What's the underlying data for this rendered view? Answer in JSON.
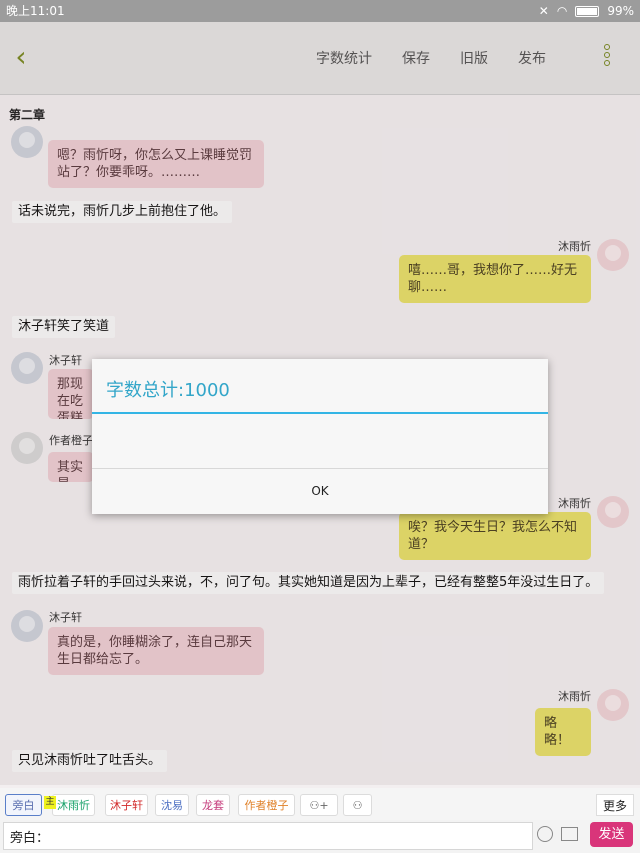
{
  "status_bar": {
    "time": "晚上11:01",
    "battery": "99%"
  },
  "toolbar": {
    "back_icon": "chevron-left",
    "actions": [
      "字数统计",
      "保存",
      "旧版",
      "发布"
    ],
    "more_icon": "vertical-dots"
  },
  "chapter": "第二章",
  "messages": [
    {
      "type": "left",
      "name": "",
      "text": "嗯？雨忻呀，你怎么又上课睡觉罚站了？你要乖呀。………"
    },
    {
      "type": "narration",
      "text": "话未说完，雨忻几步上前抱住了他。"
    },
    {
      "type": "right",
      "name": "沐雨忻",
      "text": "嘻……哥，我想你了……好无聊……"
    },
    {
      "type": "narration",
      "text": "沐子轩笑了笑道"
    },
    {
      "type": "left",
      "name": "沐子轩",
      "text": "那现在吃蛋糕"
    },
    {
      "type": "left",
      "name": "作者橙子",
      "text": "其实是"
    },
    {
      "type": "right",
      "name": "沐雨忻",
      "text": "唉？我今天生日？我怎么不知道？"
    },
    {
      "type": "narration",
      "text": "雨忻拉着子轩的手回过头来说，不，问了句。其实她知道是因为上辈子，已经有整整5年没过生日了。"
    },
    {
      "type": "left",
      "name": "沐子轩",
      "text": "真的是，你睡糊涂了，连自己那天生日都给忘了。"
    },
    {
      "type": "right",
      "name": "沐雨忻",
      "text": "略略！"
    },
    {
      "type": "narration",
      "text": "只见沐雨忻吐了吐舌头。"
    }
  ],
  "dialog": {
    "title": "字数总计:1000",
    "ok_label": "OK"
  },
  "roles": [
    {
      "label": "旁白",
      "color": "#5a6fb0"
    },
    {
      "label": "沐雨忻",
      "color": "#1aa36b"
    },
    {
      "label": "沐子轩",
      "color": "#d22a2a"
    },
    {
      "label": "沈易",
      "color": "#4b6ec2"
    },
    {
      "label": "龙套",
      "color": "#c53b7b"
    },
    {
      "label": "作者橙子",
      "color": "#e0822a"
    }
  ],
  "main_mark": "主",
  "more_label": "更多",
  "input": {
    "value": "旁白："
  },
  "send_label": "发送"
}
